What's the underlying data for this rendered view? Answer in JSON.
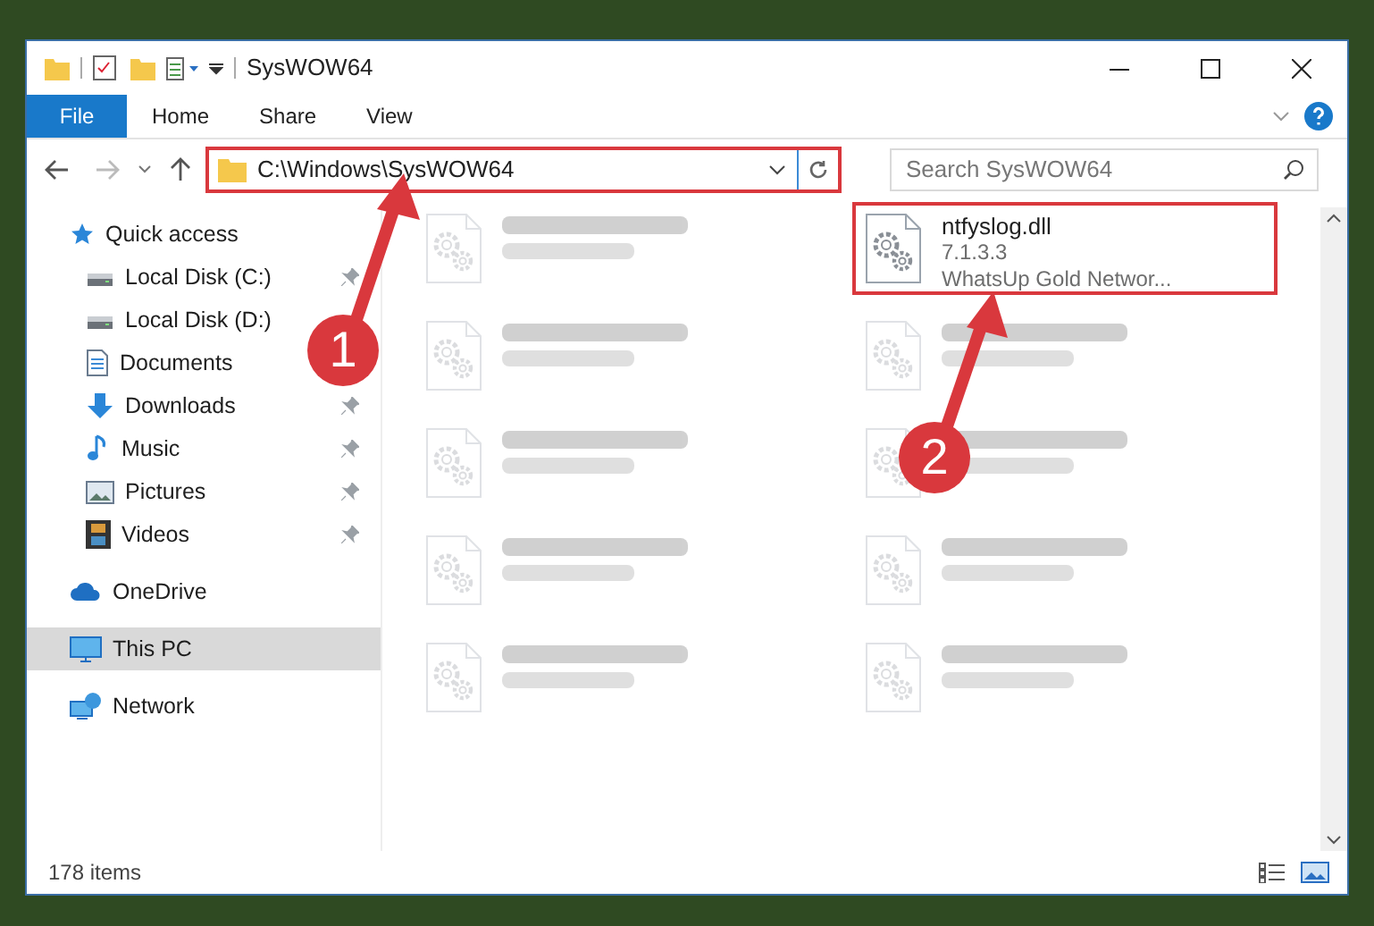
{
  "window": {
    "title": "SysWOW64"
  },
  "ribbon_tabs": [
    {
      "label": "File",
      "selected": true
    },
    {
      "label": "Home",
      "selected": false
    },
    {
      "label": "Share",
      "selected": false
    },
    {
      "label": "View",
      "selected": false
    }
  ],
  "address_bar": {
    "value": "C:\\Windows\\SysWOW64",
    "highlighted": true
  },
  "search": {
    "placeholder": "Search SysWOW64"
  },
  "sidebar": {
    "items": [
      {
        "label": "Quick access",
        "kind": "star",
        "selected": false,
        "children": [
          {
            "label": "Local Disk (C:)",
            "kind": "drive",
            "pinned": true,
            "selected": false
          },
          {
            "label": "Local Disk (D:)",
            "kind": "drive",
            "selected": false
          },
          {
            "label": "Documents",
            "kind": "document",
            "selected": false
          },
          {
            "label": "Downloads",
            "kind": "download",
            "pinned": true,
            "selected": false
          },
          {
            "label": "Music",
            "kind": "music",
            "pinned": true,
            "selected": false
          },
          {
            "label": "Pictures",
            "kind": "picture",
            "pinned": true,
            "selected": false
          },
          {
            "label": "Videos",
            "kind": "video",
            "pinned": true,
            "selected": false
          }
        ]
      },
      {
        "label": "OneDrive",
        "kind": "cloud",
        "selected": false
      },
      {
        "label": "This PC",
        "kind": "pc",
        "selected": true
      },
      {
        "label": "Network",
        "kind": "network",
        "selected": false
      }
    ]
  },
  "files": [
    {
      "kind": "blurred"
    },
    {
      "kind": "file",
      "name": "ntfyslog.dll",
      "details": [
        "7.1.3.3",
        "WhatsUp Gold Networ..."
      ],
      "highlighted": true
    },
    {
      "kind": "blurred"
    },
    {
      "kind": "blurred"
    },
    {
      "kind": "blurred"
    },
    {
      "kind": "blurred"
    },
    {
      "kind": "blurred"
    },
    {
      "kind": "blurred"
    },
    {
      "kind": "blurred"
    },
    {
      "kind": "blurred"
    }
  ],
  "callouts": [
    {
      "number": "1"
    },
    {
      "number": "2"
    }
  ],
  "status_bar": {
    "item_count": "178 items"
  }
}
